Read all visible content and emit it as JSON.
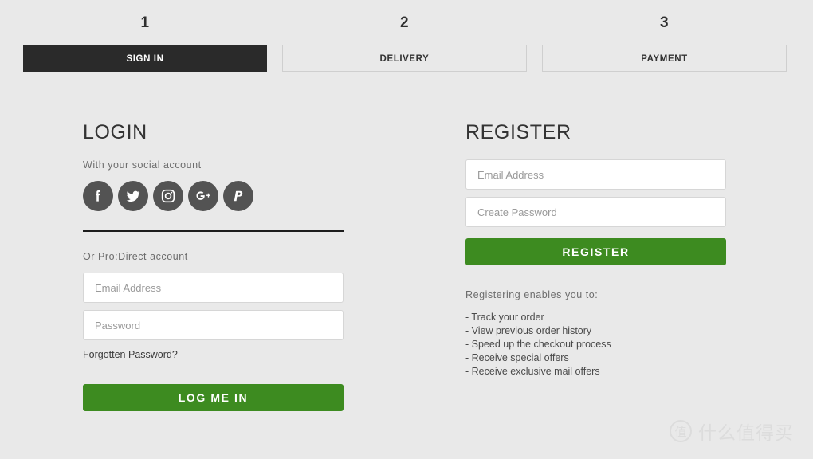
{
  "checkout_steps": [
    {
      "number": "1",
      "label": "SIGN IN",
      "state": "active"
    },
    {
      "number": "2",
      "label": "DELIVERY",
      "state": "inactive"
    },
    {
      "number": "3",
      "label": "PAYMENT",
      "state": "inactive"
    }
  ],
  "login": {
    "title": "LOGIN",
    "social_label": "With your social account",
    "social_icons": [
      "facebook-icon",
      "twitter-icon",
      "instagram-icon",
      "google-plus-icon",
      "paypal-icon"
    ],
    "account_label": "Or Pro:Direct account",
    "email_placeholder": "Email Address",
    "email_value": "",
    "password_placeholder": "Password",
    "password_value": "",
    "forgot_link": "Forgotten Password?",
    "submit_label": "LOG ME IN"
  },
  "register": {
    "title": "REGISTER",
    "email_placeholder": "Email Address",
    "email_value": "",
    "password_placeholder": "Create Password",
    "password_value": "",
    "submit_label": "REGISTER",
    "benefits_title": "Registering enables you to:",
    "benefits": [
      "- Track your order",
      "- View previous order history",
      "- Speed up the checkout process",
      "- Receive special offers",
      "- Receive exclusive mail offers"
    ]
  },
  "watermark": {
    "badge": "值",
    "text": "什么值得买"
  },
  "colors": {
    "page_background": "#e9e9e9",
    "active_tab": "#2a2a2a",
    "accent_green": "#3d8b20",
    "social_circle": "#535353",
    "divider": "#dcdcdc"
  }
}
